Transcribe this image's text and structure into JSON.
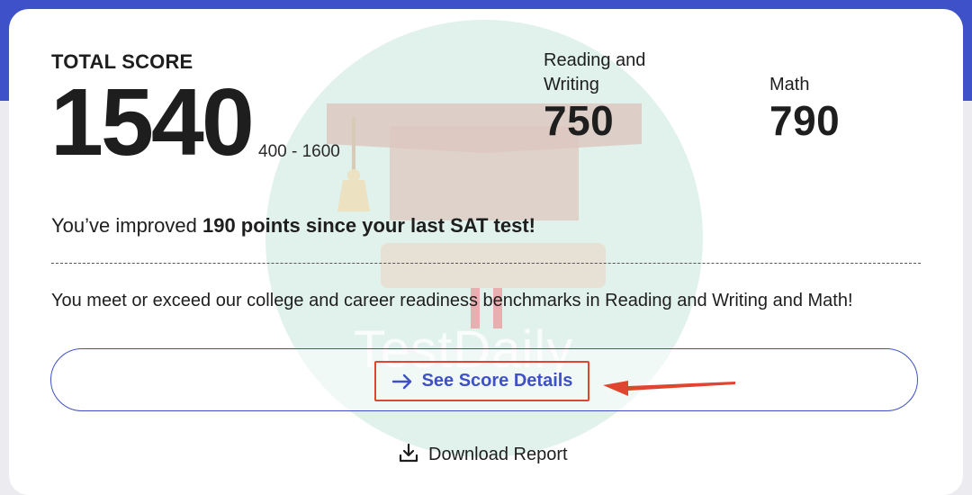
{
  "score_card": {
    "total_label": "TOTAL SCORE",
    "total_score": "1540",
    "score_range": "400 - 1600",
    "sections": [
      {
        "label_line1": "Reading and",
        "label_line2": "Writing",
        "score": "750"
      },
      {
        "label": "Math",
        "score": "790"
      }
    ]
  },
  "improvement": {
    "prefix": "You’ve improved ",
    "highlight": "190 points since your last SAT test!"
  },
  "benchmark_text": "You meet or exceed our college and career readiness benchmarks in Reading and Writing and Math!",
  "actions": {
    "details_label": "See Score Details",
    "download_label": "Download Report"
  },
  "watermark_text": "TestDaily",
  "colors": {
    "accent": "#3f51c8",
    "annotation": "#e0462f",
    "text": "#1e1e1e"
  },
  "icons": {
    "details": "arrow-right-icon",
    "download": "download-icon"
  }
}
